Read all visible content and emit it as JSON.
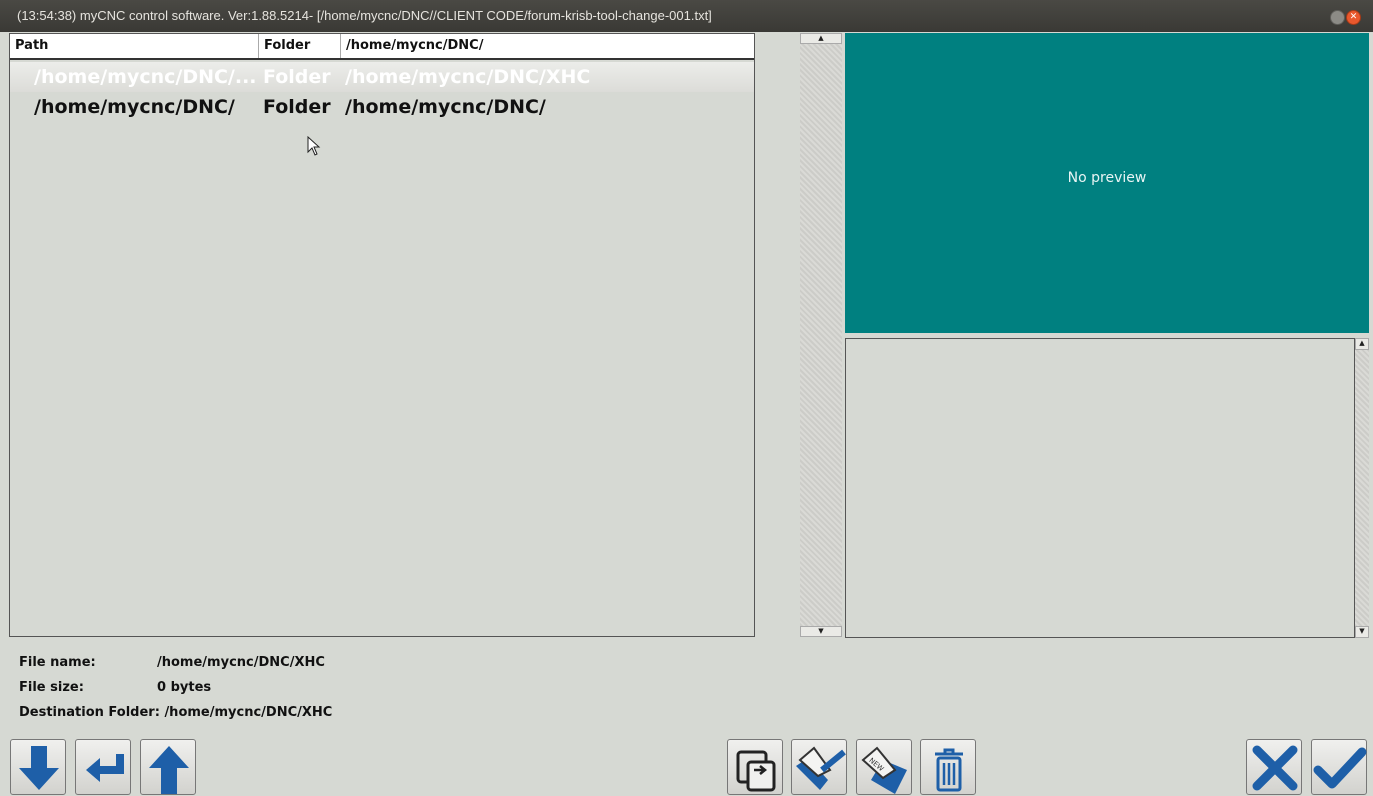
{
  "window": {
    "title": "(13:54:38)  myCNC control software. Ver:1.88.5214-  [/home/mycnc/DNC//CLIENT CODE/forum-krisb-tool-change-001.txt]"
  },
  "table": {
    "headers": [
      "Path",
      "Folder",
      "/home/mycnc/DNC/"
    ],
    "rows": [
      {
        "path": "/home/mycnc/DNC/...",
        "type": "Folder",
        "target": "/home/mycnc/DNC/XHC",
        "selected": true
      },
      {
        "path": "/home/mycnc/DNC/",
        "type": "Folder",
        "target": "/home/mycnc/DNC/",
        "selected": false
      }
    ]
  },
  "preview": {
    "text": "No preview",
    "background": "#008080"
  },
  "info": {
    "file_name_label": "File name:",
    "file_name_value": "/home/mycnc/DNC/XHC",
    "file_size_label": "File size:",
    "file_size_value": "0 bytes",
    "dest_label": "Destination Folder:",
    "dest_value": "/home/mycnc/DNC/XHC"
  },
  "toolbar": {
    "left": [
      "arrow-down-icon",
      "enter-icon",
      "arrow-up-icon"
    ],
    "middle": [
      "copy-icon",
      "save-icon",
      "save-as-new-icon",
      "trash-icon"
    ],
    "right": [
      "cancel-icon",
      "ok-icon"
    ]
  },
  "colors": {
    "accent": "#1e5fa8",
    "preview_bg": "#008080"
  }
}
